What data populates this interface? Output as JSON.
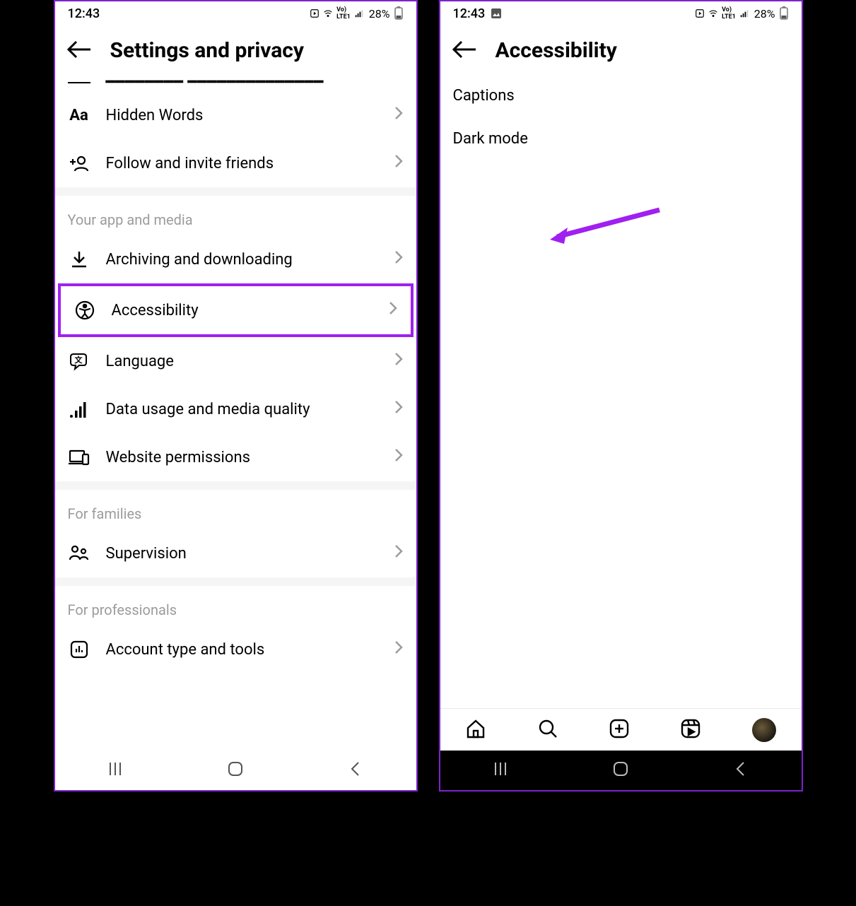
{
  "status": {
    "time": "12:43",
    "battery": "28%"
  },
  "left": {
    "title": "Settings and privacy",
    "items_top": [
      {
        "icon": "aa",
        "label": "Hidden Words"
      },
      {
        "icon": "invite",
        "label": "Follow and invite friends"
      }
    ],
    "section_app": {
      "header": "Your app and media",
      "items": [
        {
          "icon": "download",
          "label": "Archiving and downloading"
        },
        {
          "icon": "access",
          "label": "Accessibility",
          "highlighted": true
        },
        {
          "icon": "lang",
          "label": "Language"
        },
        {
          "icon": "data",
          "label": "Data usage and media quality"
        },
        {
          "icon": "web",
          "label": "Website permissions"
        }
      ]
    },
    "section_fam": {
      "header": "For families",
      "items": [
        {
          "icon": "supervision",
          "label": "Supervision"
        }
      ]
    },
    "section_pro": {
      "header": "For professionals",
      "items": [
        {
          "icon": "account",
          "label": "Account type and tools"
        }
      ]
    }
  },
  "right": {
    "title": "Accessibility",
    "items": [
      {
        "label": "Captions"
      },
      {
        "label": "Dark mode"
      }
    ]
  },
  "annotation_color": "#a020f0"
}
